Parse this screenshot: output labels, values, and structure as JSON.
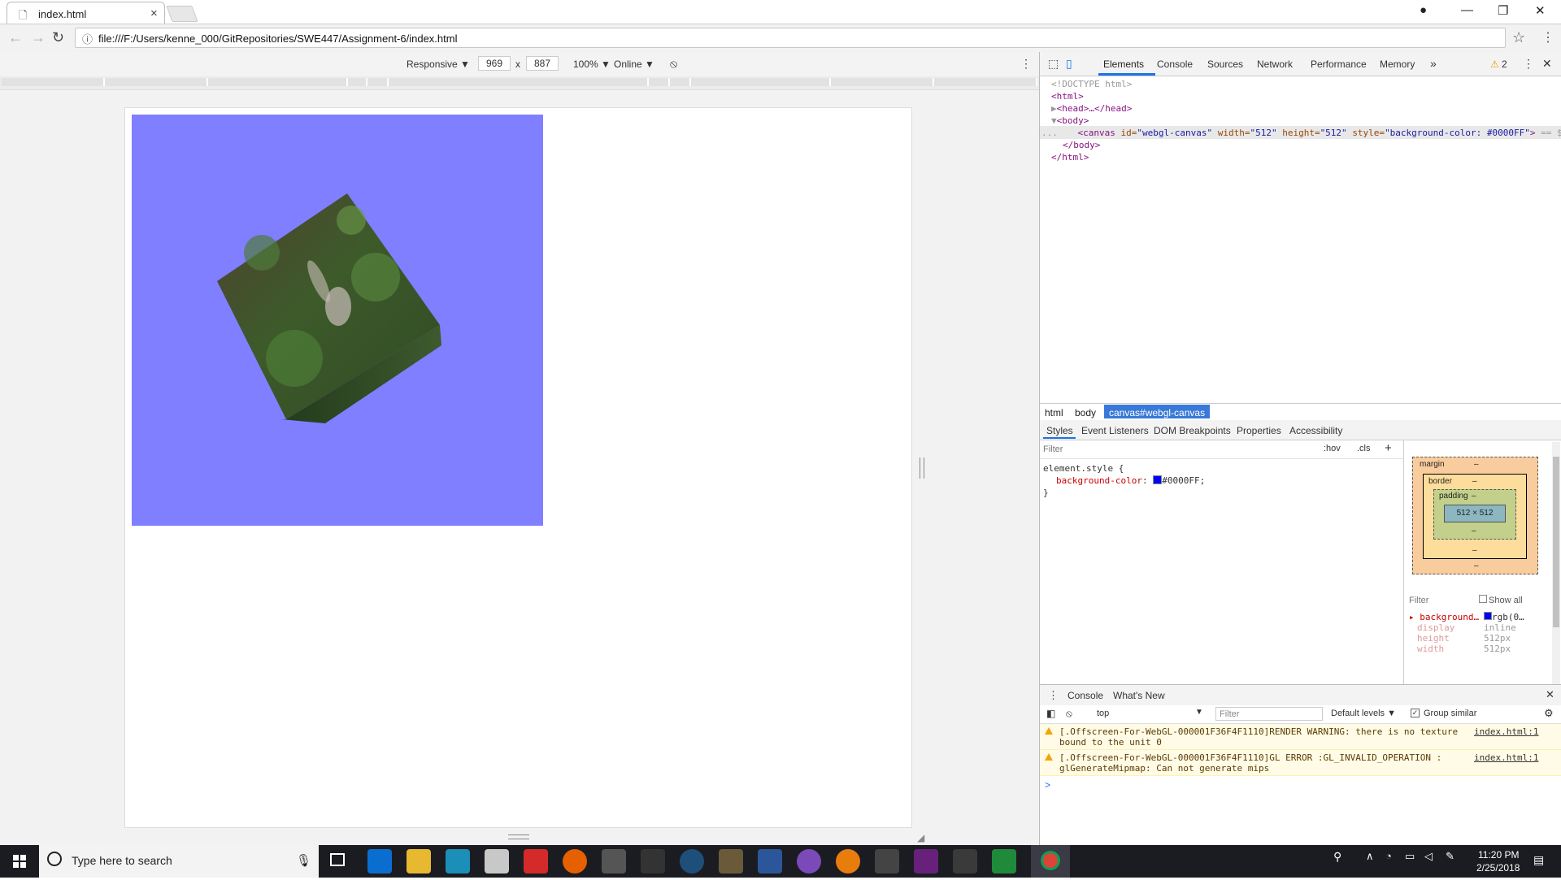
{
  "browser": {
    "tab_title": "index.html",
    "url": "file:///F:/Users/kenne_000/GitRepositories/SWE447/Assignment-6/index.html"
  },
  "device_toolbar": {
    "mode": "Responsive ▼",
    "width": "969",
    "times": "x",
    "height": "887",
    "zoom": "100% ▼",
    "network": "Online ▼"
  },
  "devtools": {
    "tabs": [
      "Elements",
      "Console",
      "Sources",
      "Network",
      "Performance",
      "Memory"
    ],
    "more": "»",
    "warnings": "2",
    "dom": {
      "doctype": "<!DOCTYPE html>",
      "html_open": "<html>",
      "head": "<head>…</head>",
      "body_open": "<body>",
      "canvas_tag": "<canvas",
      "canvas_id_attr": "id=",
      "canvas_id_val": "\"webgl-canvas\"",
      "canvas_width_attr": "width=",
      "canvas_width_val": "\"512\"",
      "canvas_height_attr": "height=",
      "canvas_height_val": "\"512\"",
      "canvas_style_attr": "style=",
      "canvas_style_val": "\"background-color: #0000FF\"",
      "canvas_close": ">",
      "selected_marker": "== $0",
      "body_close": "</body>",
      "html_close": "</html>",
      "ellipsis": "..."
    },
    "breadcrumbs": [
      "html",
      "body",
      "canvas#webgl-canvas"
    ],
    "subtabs": [
      "Styles",
      "Event Listeners",
      "DOM Breakpoints",
      "Properties",
      "Accessibility"
    ],
    "styles": {
      "filter_placeholder": "Filter",
      "hov": ":hov",
      "cls": ".cls",
      "plus": "+",
      "rule_selector": "element.style {",
      "prop": "background-color",
      "colon": ":",
      "value": "#0000FF;",
      "close": "}"
    },
    "boxmodel": {
      "margin": "margin",
      "border": "border",
      "padding": "padding",
      "dash": "–",
      "content": "512 × 512"
    },
    "computed": {
      "filter": "Filter",
      "show_all": "Show all",
      "rows": [
        {
          "prop": "background…",
          "value": "rgb(0…"
        },
        {
          "prop": "display",
          "value": "inline"
        },
        {
          "prop": "height",
          "value": "512px"
        },
        {
          "prop": "width",
          "value": "512px"
        }
      ]
    },
    "drawer": {
      "tabs": [
        "Console",
        "What's New"
      ],
      "context": "top",
      "filter_placeholder": "Filter",
      "levels": "Default levels ▼",
      "group_similar": "Group similar",
      "messages": [
        {
          "text": "[.Offscreen-For-WebGL-000001F36F4F1110]RENDER WARNING: there is no texture bound to the unit 0",
          "source": "index.html:1"
        },
        {
          "text": "[.Offscreen-For-WebGL-000001F36F4F1110]GL ERROR :GL_INVALID_OPERATION : glGenerateMipmap: Can not generate mips",
          "source": "index.html:1"
        }
      ],
      "prompt": ">"
    }
  },
  "taskbar": {
    "search_placeholder": "Type here to search",
    "time": "11:20 PM",
    "date": "2/25/2018"
  },
  "colors": {
    "canvas_bg": "#7f7fff",
    "accent": "#1a73e8",
    "taskbar": "#1b1c22"
  }
}
